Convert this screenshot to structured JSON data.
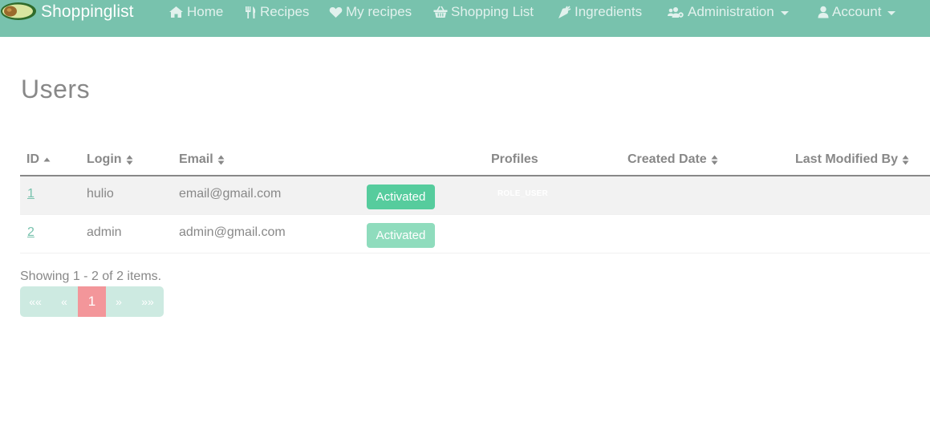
{
  "navbar": {
    "brand": "Shoppinglist",
    "items": [
      {
        "label": "Home",
        "icon": "home-icon"
      },
      {
        "label": "Recipes",
        "icon": "utensils-icon"
      },
      {
        "label": "My recipes",
        "icon": "heart-icon"
      },
      {
        "label": "Shopping List",
        "icon": "basket-icon"
      },
      {
        "label": "Ingredients",
        "icon": "carrot-icon"
      },
      {
        "label": "Administration",
        "icon": "users-cog-icon",
        "dropdown": true
      },
      {
        "label": "Account",
        "icon": "user-icon",
        "dropdown": true
      }
    ],
    "colors": {
      "background": "#78c2ad",
      "text": "#ffffff"
    }
  },
  "page": {
    "title": "Users"
  },
  "table": {
    "columns": [
      {
        "label": "ID",
        "sort": "ascending"
      },
      {
        "label": "Login",
        "sort": "both"
      },
      {
        "label": "Email",
        "sort": "both"
      },
      {
        "label": "Profiles",
        "sort": "none"
      },
      {
        "label": "Created Date",
        "sort": "both"
      },
      {
        "label": "Last Modified By",
        "sort": "both"
      }
    ],
    "rows": [
      {
        "id": "1",
        "login": "hulio",
        "email": "email@gmail.com",
        "status": "Activated",
        "profiles": "ROLE_USER"
      },
      {
        "id": "2",
        "login": "admin",
        "email": "admin@gmail.com",
        "status": "Activated",
        "profiles": ""
      }
    ]
  },
  "pagination": {
    "info": "Showing 1 - 2 of 2 items.",
    "first": "««",
    "prev": "«",
    "current": "1",
    "next": "»",
    "last": "»»"
  },
  "colors": {
    "accent": "#78c2ad",
    "success": "#56cc9d",
    "pagination_active": "#f3969a",
    "text": "#888888"
  }
}
